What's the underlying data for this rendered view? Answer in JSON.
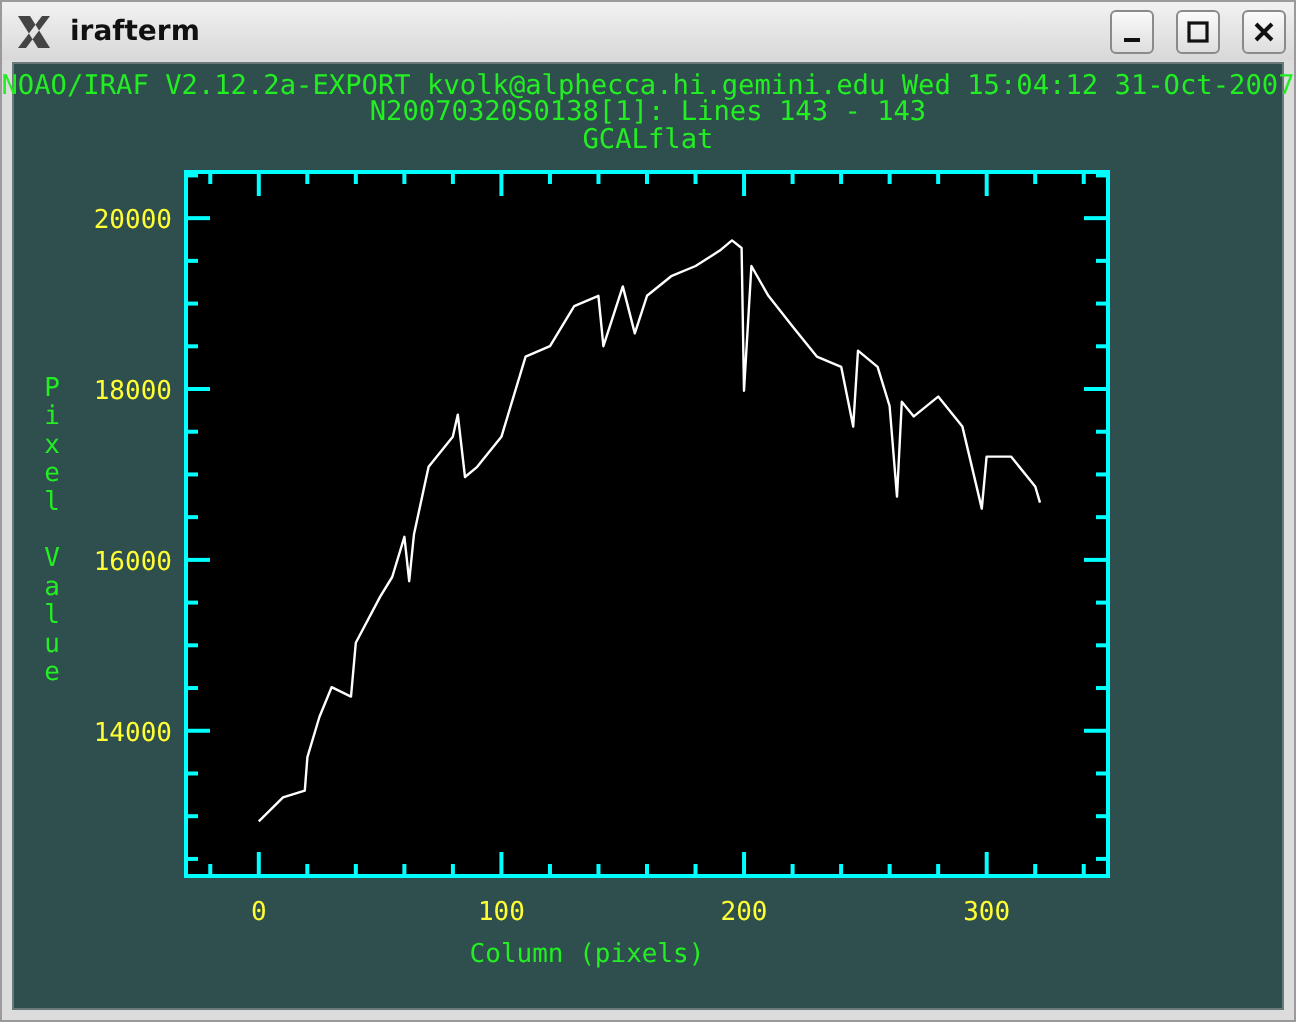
{
  "window": {
    "title": "irafterm",
    "buttons": [
      {
        "kind": "minimize"
      },
      {
        "kind": "maximize"
      },
      {
        "kind": "close"
      }
    ]
  },
  "header_lines": [
    "NOAO/IRAF V2.12.2a-EXPORT kvolk@alphecca.hi.gemini.edu Wed 15:04:12 31-Oct-2007",
    "N20070320S0138[1]: Lines 143 - 143",
    "GCALflat"
  ],
  "plot": {
    "chart_data": {
      "type": "line",
      "xlabel": "Column (pixels)",
      "ylabel": "Pixel Value",
      "xlim": [
        -30,
        350
      ],
      "ylim": [
        12300,
        20540
      ],
      "xticks": [
        0,
        100,
        200,
        300
      ],
      "yticks": [
        14000,
        16000,
        18000,
        20000
      ],
      "x": [
        0,
        10,
        19,
        20,
        25,
        30,
        38,
        40,
        50,
        55,
        60,
        62,
        64,
        70,
        80,
        82,
        85,
        90,
        100,
        110,
        120,
        130,
        140,
        142,
        150,
        155,
        160,
        170,
        180,
        190,
        195,
        199,
        200,
        203,
        210,
        220,
        230,
        240,
        245,
        247,
        255,
        260,
        263,
        265,
        270,
        280,
        290,
        298,
        300,
        310,
        320,
        322
      ],
      "series": [
        {
          "color": "#ffffff",
          "values": [
            12940,
            13220,
            13300,
            13690,
            14160,
            14510,
            14400,
            15030,
            15570,
            15800,
            16270,
            15750,
            16300,
            17090,
            17440,
            17700,
            16970,
            17090,
            17440,
            18380,
            18500,
            18970,
            19090,
            18500,
            19200,
            18650,
            19090,
            19320,
            19440,
            19620,
            19740,
            19650,
            17980,
            19440,
            19090,
            18730,
            18380,
            18260,
            17560,
            18450,
            18260,
            17800,
            16740,
            17850,
            17680,
            17910,
            17560,
            16600,
            17210,
            17210,
            16860,
            16670
          ]
        }
      ]
    }
  }
}
